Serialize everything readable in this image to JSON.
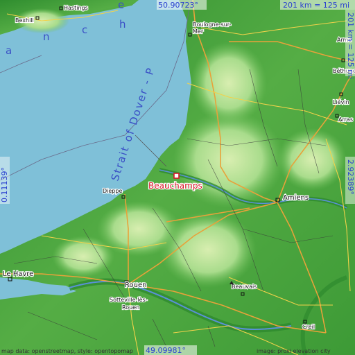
{
  "map": {
    "main_place": "Beauchamps",
    "sea_labels": {
      "channel": [
        "a",
        "n",
        "c",
        "h",
        "e"
      ],
      "strait": "Strait of Dover - P"
    },
    "cities": [
      {
        "name": "Hastings",
        "size": "sm"
      },
      {
        "name": "Bexhill",
        "size": "sm"
      },
      {
        "name": "Boulogne-sur-",
        "size": "sm"
      },
      {
        "name": "Mer",
        "size": "sm"
      },
      {
        "name": "Arme",
        "size": "sm"
      },
      {
        "name": "Béthune",
        "size": "sm"
      },
      {
        "name": "Liévin",
        "size": "sm"
      },
      {
        "name": "Arras",
        "size": "sm"
      },
      {
        "name": "Dieppe",
        "size": "sm"
      },
      {
        "name": "Amiens",
        "size": "lg"
      },
      {
        "name": "Le Havre",
        "size": "lg"
      },
      {
        "name": "Rouen",
        "size": "lg"
      },
      {
        "name": "Sotteville-lès-",
        "size": "sm"
      },
      {
        "name": "Rouen",
        "size": "sm"
      },
      {
        "name": "Beauvais",
        "size": "sm"
      },
      {
        "name": "Creil",
        "size": "sm"
      }
    ],
    "coords": {
      "top": "50.90723°",
      "bottom": "49.09981°",
      "left": "0.11139°",
      "right": "2.92389°"
    },
    "scale": {
      "top": "201 km = 125 mi",
      "right": "201 km = 125 mi"
    },
    "attribution_left": "map data: openstreetmap, style: opentopomap",
    "attribution_right": "image: proxi elevation city"
  },
  "colors": {
    "sea": "#7fc0d8",
    "land_low": "#3a9a3a",
    "land_mid": "#9bd48a",
    "land_high": "#c9e9a8",
    "main_label": "#d81828",
    "coord_text": "#2a40d0"
  }
}
